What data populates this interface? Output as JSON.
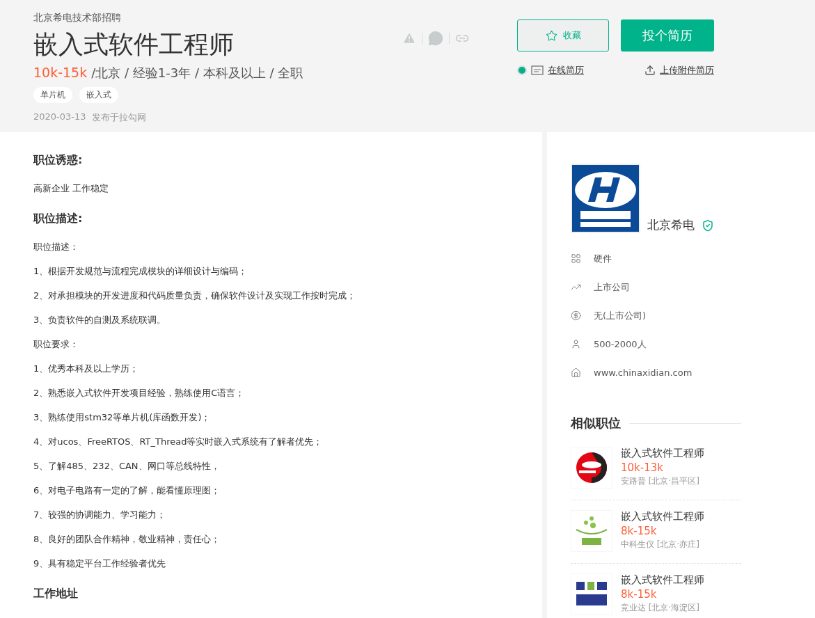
{
  "header": {
    "department": "北京希电技术部招聘",
    "title": "嵌入式软件工程师",
    "salary": "10k-15k",
    "requirements": "/北京 / 经验1-3年 / 本科及以上 / 全职",
    "tags": [
      "单片机",
      "嵌入式"
    ],
    "date": "2020-03-13",
    "source": "发布于拉勾网",
    "actions": {
      "favorite": "收藏",
      "apply": "投个简历",
      "online_resume": {
        "label": "在线简历",
        "selected": true
      },
      "upload_resume": "上传附件简历"
    }
  },
  "sections": [
    {
      "heading": "职位诱惑:",
      "lines": [
        "高新企业 工作稳定"
      ]
    },
    {
      "heading": "职位描述:",
      "lines": [
        "职位描述：",
        "1、根据开发规范与流程完成模块的详细设计与编码；",
        "2、对承担模块的开发进度和代码质量负责，确保软件设计及实现工作按时完成；",
        "3、负责软件的自测及系统联调。",
        "职位要求：",
        "1、优秀本科及以上学历；",
        "2、熟悉嵌入式软件开发项目经验，熟练使用C语言；",
        "3、熟练使用stm32等单片机(库函数开发)；",
        "4、对ucos、FreeRTOS、RT_Thread等实时嵌入式系统有了解者优先；",
        "5、了解485、232、CAN、网口等总线特性，",
        "6、对电子电路有一定的了解，能看懂原理图；",
        "7、较强的协调能力、学习能力；",
        "8、良好的团队合作精神，敬业精神，责任心；",
        "9、具有稳定平台工作经验者优先"
      ]
    },
    {
      "heading": "工作地址"
    }
  ],
  "company": {
    "name": "北京希电",
    "verified": true,
    "facts": [
      {
        "kind": "industry",
        "text": "硬件"
      },
      {
        "kind": "stage",
        "text": "上市公司"
      },
      {
        "kind": "funding",
        "text": "无(上市公司)"
      },
      {
        "kind": "size",
        "text": "500-2000人"
      },
      {
        "kind": "website",
        "text": "www.chinaxidian.com"
      }
    ]
  },
  "similar": {
    "title": "相似职位",
    "jobs": [
      {
        "title": "嵌入式软件工程师",
        "salary": "10k-13k",
        "company": "安路普 [北京·昌平区]"
      },
      {
        "title": "嵌入式软件工程师",
        "salary": "8k-15k",
        "company": "中科生仪 [北京·亦庄]"
      },
      {
        "title": "嵌入式软件工程师",
        "salary": "8k-15k",
        "company": "竞业达 [北京·海淀区]"
      }
    ]
  }
}
